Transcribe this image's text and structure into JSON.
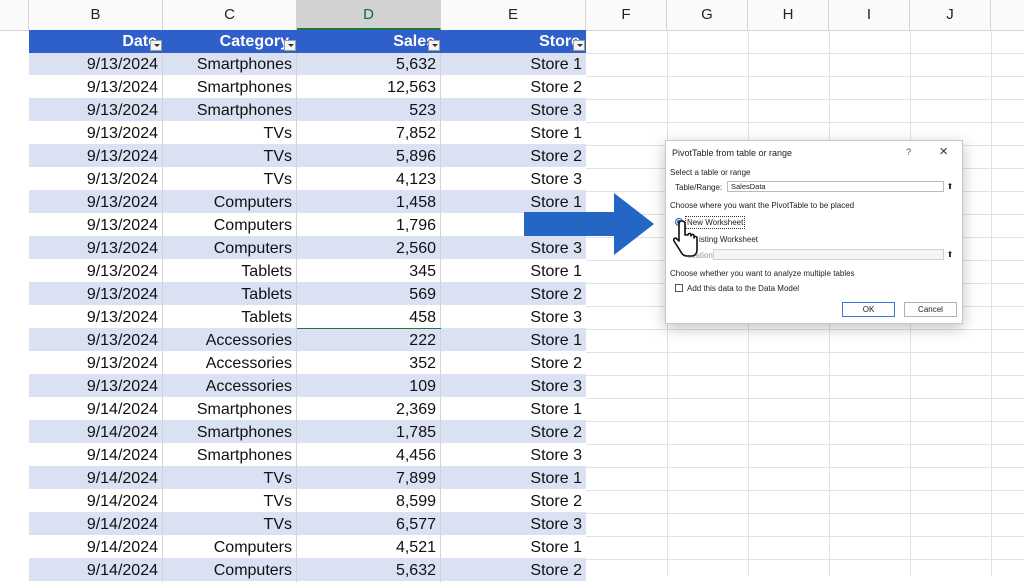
{
  "columns": [
    "B",
    "C",
    "D",
    "E",
    "F",
    "G",
    "H",
    "I",
    "J"
  ],
  "selected_column": "D",
  "table": {
    "headers": [
      "Date",
      "Category",
      "Sales",
      "Store"
    ],
    "rows": [
      [
        "9/13/2024",
        "Smartphones",
        "5,632",
        "Store 1"
      ],
      [
        "9/13/2024",
        "Smartphones",
        "12,563",
        "Store 2"
      ],
      [
        "9/13/2024",
        "Smartphones",
        "523",
        "Store 3"
      ],
      [
        "9/13/2024",
        "TVs",
        "7,852",
        "Store 1"
      ],
      [
        "9/13/2024",
        "TVs",
        "5,896",
        "Store 2"
      ],
      [
        "9/13/2024",
        "TVs",
        "4,123",
        "Store 3"
      ],
      [
        "9/13/2024",
        "Computers",
        "1,458",
        "Store 1"
      ],
      [
        "9/13/2024",
        "Computers",
        "1,796",
        ""
      ],
      [
        "9/13/2024",
        "Computers",
        "2,560",
        "Store 3"
      ],
      [
        "9/13/2024",
        "Tablets",
        "345",
        "Store 1"
      ],
      [
        "9/13/2024",
        "Tablets",
        "569",
        "Store 2"
      ],
      [
        "9/13/2024",
        "Tablets",
        "458",
        "Store 3"
      ],
      [
        "9/13/2024",
        "Accessories",
        "222",
        "Store 1"
      ],
      [
        "9/13/2024",
        "Accessories",
        "352",
        "Store 2"
      ],
      [
        "9/13/2024",
        "Accessories",
        "109",
        "Store 3"
      ],
      [
        "9/14/2024",
        "Smartphones",
        "2,369",
        "Store 1"
      ],
      [
        "9/14/2024",
        "Smartphones",
        "1,785",
        "Store 2"
      ],
      [
        "9/14/2024",
        "Smartphones",
        "4,456",
        "Store 3"
      ],
      [
        "9/14/2024",
        "TVs",
        "7,899",
        "Store 1"
      ],
      [
        "9/14/2024",
        "TVs",
        "8,599",
        "Store 2"
      ],
      [
        "9/14/2024",
        "TVs",
        "6,577",
        "Store 3"
      ],
      [
        "9/14/2024",
        "Computers",
        "4,521",
        "Store 1"
      ],
      [
        "9/14/2024",
        "Computers",
        "5,632",
        "Store 2"
      ]
    ]
  },
  "dialog": {
    "title": "PivotTable from table or range",
    "help": "?",
    "close": "✕",
    "section1": "Select a table or range",
    "table_range_label": "Table/Range:",
    "table_range_value": "SalesData",
    "section2": "Choose where you want the PivotTable to be placed",
    "new_worksheet": "New Worksheet",
    "existing_worksheet": "Existing Worksheet",
    "existing_visible": "isting Worksheet",
    "location_label": "Location:",
    "location_visible": "ocation:",
    "location_value": "",
    "section3": "Choose whether you want to analyze multiple tables",
    "data_model": "Add this data to the Data Model",
    "ok": "OK",
    "cancel": "Cancel"
  },
  "colors": {
    "table_header": "#2f5fca",
    "band": "#d9e1f2",
    "arrow": "#2366c4",
    "accent_green": "#1e7a3c"
  },
  "icons": [
    "filter-dropdown-icon",
    "collapse-dialog-icon",
    "mouse-pointer-icon",
    "arrow-pointer"
  ]
}
